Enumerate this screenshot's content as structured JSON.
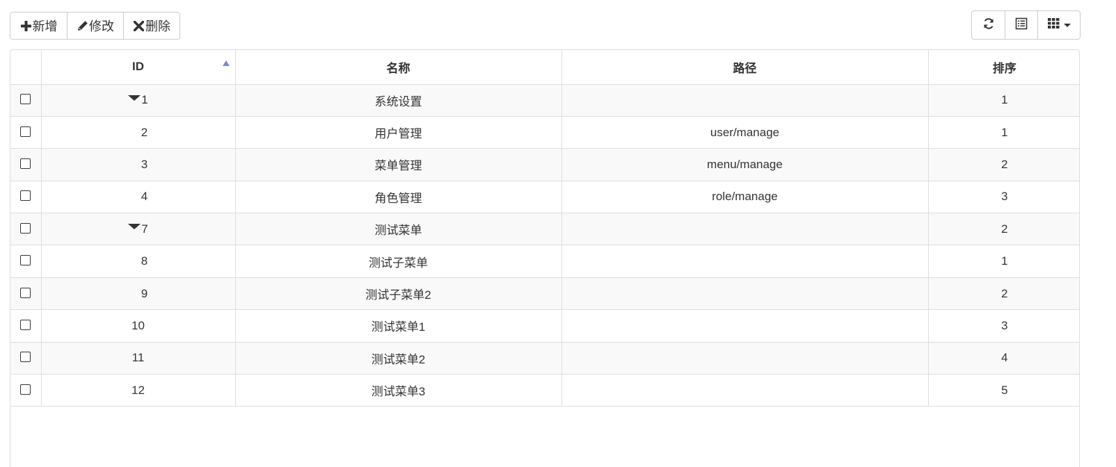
{
  "toolbar": {
    "add_label": "新增",
    "edit_label": "修改",
    "delete_label": "删除"
  },
  "table": {
    "headers": {
      "id": "ID",
      "name": "名称",
      "path": "路径",
      "order": "排序"
    },
    "sort": {
      "column": "id",
      "direction": "asc"
    },
    "rows": [
      {
        "id": "1",
        "name": "系统设置",
        "path": "",
        "order": "1",
        "expandable": true,
        "level": 0
      },
      {
        "id": "2",
        "name": "用户管理",
        "path": "user/manage",
        "order": "1",
        "expandable": false,
        "level": 1
      },
      {
        "id": "3",
        "name": "菜单管理",
        "path": "menu/manage",
        "order": "2",
        "expandable": false,
        "level": 1
      },
      {
        "id": "4",
        "name": "角色管理",
        "path": "role/manage",
        "order": "3",
        "expandable": false,
        "level": 1
      },
      {
        "id": "7",
        "name": "测试菜单",
        "path": "",
        "order": "2",
        "expandable": true,
        "level": 0
      },
      {
        "id": "8",
        "name": "测试子菜单",
        "path": "",
        "order": "1",
        "expandable": false,
        "level": 1
      },
      {
        "id": "9",
        "name": "测试子菜单2",
        "path": "",
        "order": "2",
        "expandable": false,
        "level": 1
      },
      {
        "id": "10",
        "name": "测试菜单1",
        "path": "",
        "order": "3",
        "expandable": false,
        "level": 0
      },
      {
        "id": "11",
        "name": "测试菜单2",
        "path": "",
        "order": "4",
        "expandable": false,
        "level": 0
      },
      {
        "id": "12",
        "name": "测试菜单3",
        "path": "",
        "order": "5",
        "expandable": false,
        "level": 0
      }
    ]
  },
  "colors": {
    "border": "#dddddd",
    "stripe": "#f9f9f9",
    "sort_indicator": "#7b87d6",
    "text": "#333333"
  },
  "icons": {
    "add": "plus-icon",
    "edit": "pencil-icon",
    "delete": "remove-icon",
    "refresh": "refresh-icon",
    "toggle_view": "list-alt-icon",
    "columns": "th-icon"
  }
}
